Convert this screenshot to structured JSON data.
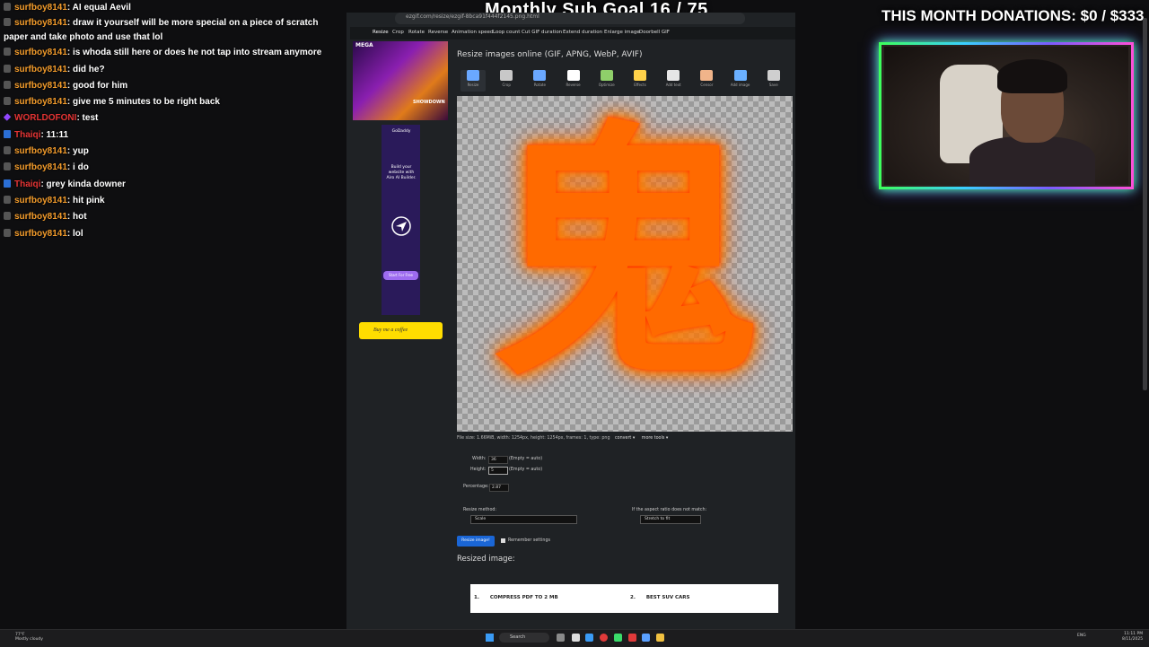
{
  "overlay": {
    "sub_goal": "Monthly Sub Goal 16 / 75",
    "donations": "THIS MONTH DONATIONS: $0 / $333"
  },
  "chat": [
    {
      "user": "surfboy8141",
      "color": "#f29b2b",
      "badge": "gray",
      "text": ": AI equal Aevil"
    },
    {
      "user": "surfboy8141",
      "color": "#f29b2b",
      "badge": "gray",
      "text": ": draw it yourself will be more special on a piece of scratch paper and take photo and use that lol"
    },
    {
      "user": "surfboy8141",
      "color": "#f29b2b",
      "badge": "gray",
      "text": ": is whoda still here or does he not tap into stream anymore"
    },
    {
      "user": "surfboy8141",
      "color": "#f29b2b",
      "badge": "gray",
      "text": ": did he?"
    },
    {
      "user": "surfboy8141",
      "color": "#f29b2b",
      "badge": "gray",
      "text": ": good for him"
    },
    {
      "user": "surfboy8141",
      "color": "#f29b2b",
      "badge": "gray",
      "text": ": give me 5 minutes to be right back"
    },
    {
      "user": "WORLDOFONI",
      "color": "#e53434",
      "badge": "purple",
      "text": ": test"
    },
    {
      "user": "Thaiqi",
      "color": "#e53434",
      "badge": "blue",
      "text": ": 11:11"
    },
    {
      "user": "surfboy8141",
      "color": "#f29b2b",
      "badge": "gray",
      "text": ": yup"
    },
    {
      "user": "surfboy8141",
      "color": "#f29b2b",
      "badge": "gray",
      "text": ": i do"
    },
    {
      "user": "Thaiqi",
      "color": "#e53434",
      "badge": "blue",
      "text": ": grey kinda downer"
    },
    {
      "user": "surfboy8141",
      "color": "#f29b2b",
      "badge": "gray",
      "text": ": hit pink"
    },
    {
      "user": "surfboy8141",
      "color": "#f29b2b",
      "badge": "gray",
      "text": ": hot"
    },
    {
      "user": "surfboy8141",
      "color": "#f29b2b",
      "badge": "gray",
      "text": ": lol"
    }
  ],
  "browser": {
    "url": "ezgif.com/resize/ezgif-8bca91f444f2145.png.html",
    "nav": [
      "Resize",
      "Crop",
      "Rotate",
      "Reverse",
      "Animation speed",
      "Loop count",
      "Cut GIF duration",
      "Extend duration",
      "Enlarge image",
      "Doorbell GIF"
    ],
    "page_title": "Resize images online (GIF, APNG, WebP, AVIF)",
    "tools": [
      {
        "label": "Resize",
        "color": "#6aa8ff"
      },
      {
        "label": "Crop",
        "color": "#c8c8c8"
      },
      {
        "label": "Rotate",
        "color": "#6aa8ff"
      },
      {
        "label": "Reverse",
        "color": "#ffffff"
      },
      {
        "label": "Optimize",
        "color": "#8fcf6a"
      },
      {
        "label": "Effects",
        "color": "#ffd24a"
      },
      {
        "label": "Add text",
        "color": "#e6e6e6"
      },
      {
        "label": "Censor",
        "color": "#f0b48a"
      },
      {
        "label": "Add image",
        "color": "#6ab0ff"
      },
      {
        "label": "Save",
        "color": "#cfcfcf"
      }
    ],
    "glyph": "鬼",
    "file_info": "File size: 1.66MiB, width: 1254px, height: 1254px, frames: 1, type: png",
    "file_actions": [
      "convert ▾",
      "more tools ▾"
    ],
    "width_label": "Width:",
    "width_value": "36",
    "height_label": "Height:",
    "height_value": "5",
    "empty_auto": "(Empty = auto)",
    "percentage_label": "Percentage:",
    "percentage_value": "2.87",
    "resize_method_label": "Resize method:",
    "resize_method_value": "Scale",
    "aspect_label": "If the aspect ratio does not match:",
    "aspect_value": "Stretch to fit",
    "resize_button": "Resize image!",
    "remember_label": "Remember settings",
    "resized_title": "Resized image:",
    "ad_top_brand": "MEGA",
    "ad_top_text": "SHOWDOWN",
    "ad_side_brand": "GoDaddy",
    "ad_side_text": "Build your website with Airo AI Builder.",
    "ad_side_button": "Start For Free",
    "coffee_label": "Buy me a coffee",
    "ad_bottom": [
      {
        "num": "1.",
        "text": "COMPRESS PDF TO 2 MB"
      },
      {
        "num": "2.",
        "text": "BEST SUV CARS"
      }
    ]
  },
  "taskbar": {
    "weather_temp": "77°F",
    "weather_desc": "Mostly cloudy",
    "search": "Search",
    "tray_lang": "ENG",
    "time": "11:11 PM",
    "date": "8/11/2025"
  }
}
